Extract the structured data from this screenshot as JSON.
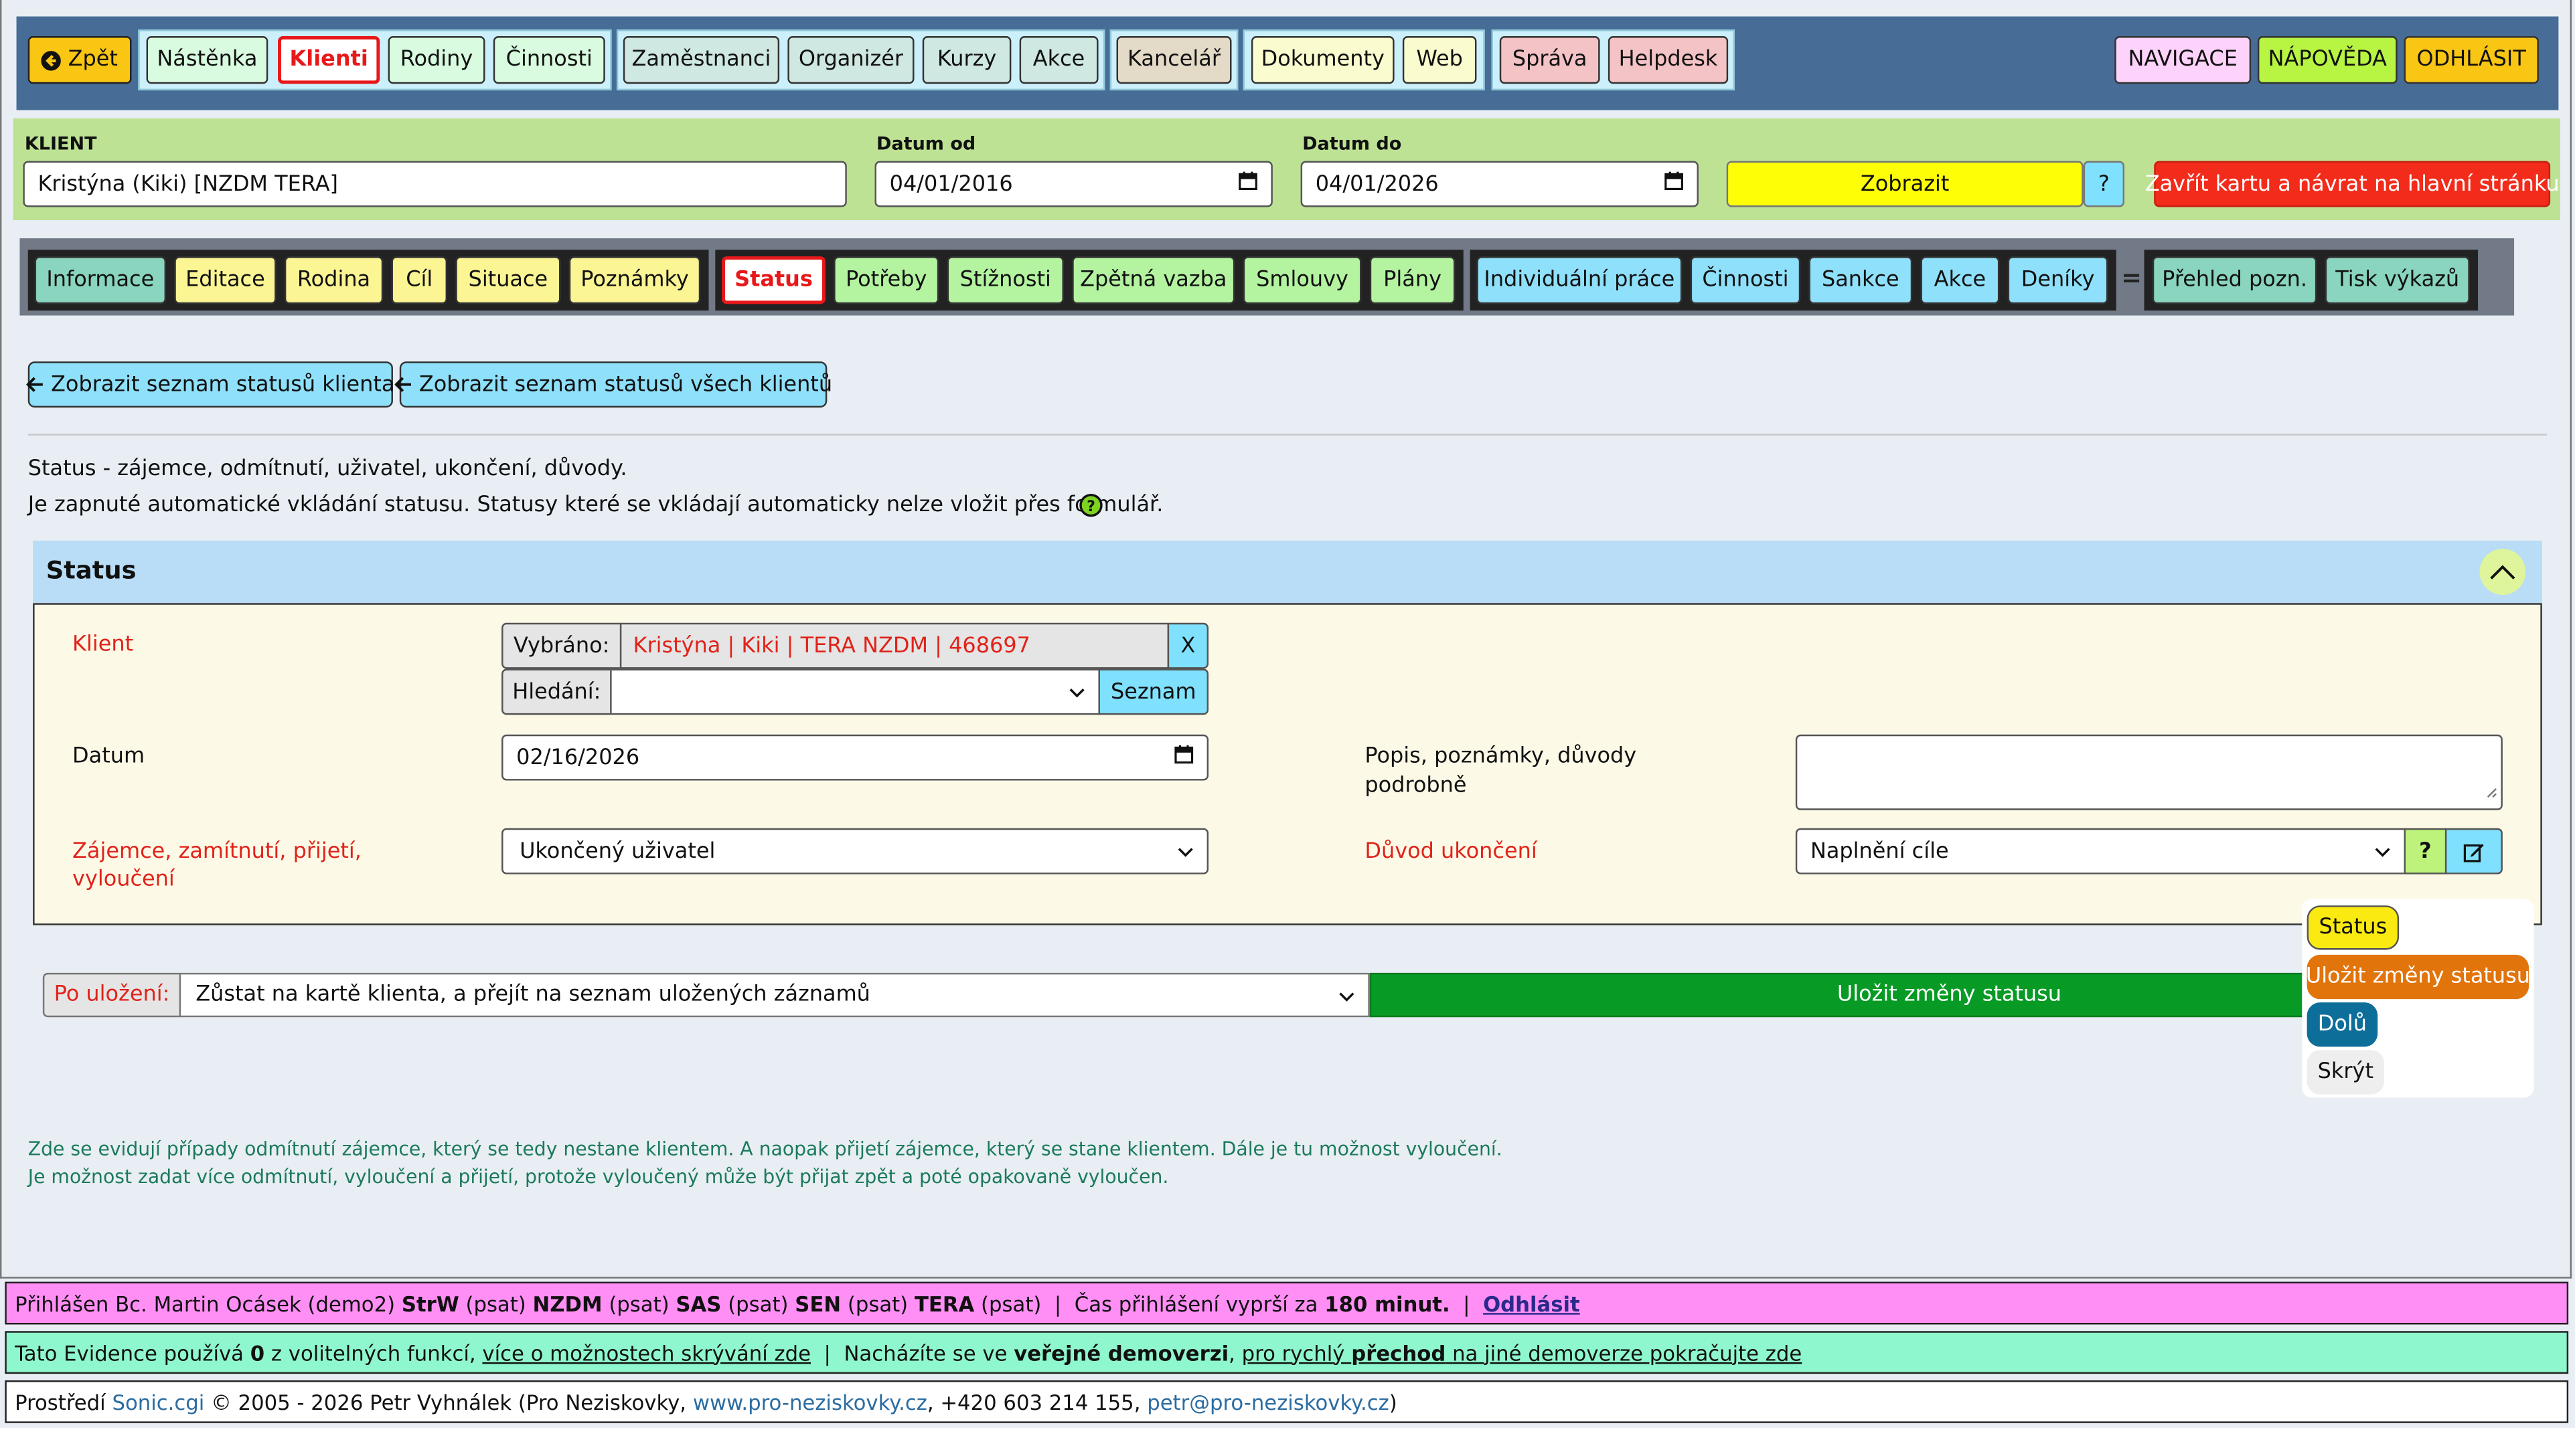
{
  "topnav": {
    "back": "Zpět",
    "items": [
      "Nástěnka",
      "Klienti",
      "Rodiny",
      "Činnosti",
      "Zaměstnanci",
      "Organizér",
      "Kurzy",
      "Akce",
      "Kancelář",
      "Dokumenty",
      "Web",
      "Správa",
      "Helpdesk"
    ],
    "right": [
      "NAVIGACE",
      "NÁPOVĚDA",
      "ODHLÁSIT"
    ]
  },
  "filter": {
    "client_label": "KLIENT",
    "client_value": "Kristýna (Kiki) [NZDM TERA]",
    "date_from_label": "Datum od",
    "date_from_value": "04/01/2016",
    "date_to_label": "Datum do",
    "date_to_value": "04/01/2026",
    "show_button": "Zobrazit",
    "help_button": "?",
    "close_button": "Zavřít kartu a návrat na hlavní stránku"
  },
  "tabs": {
    "group1": [
      "Informace",
      "Editace",
      "Rodina",
      "Cíl",
      "Situace",
      "Poznámky"
    ],
    "group2": [
      "Status",
      "Potřeby",
      "Stížnosti",
      "Zpětná vazba",
      "Smlouvy",
      "Plány"
    ],
    "group3": [
      "Individuální práce",
      "Činnosti",
      "Sankce",
      "Akce",
      "Deníky"
    ],
    "separator": "=",
    "group4": [
      "Přehled pozn.",
      "Tisk výkazů"
    ]
  },
  "actions": {
    "list_client": "Zobrazit seznam statusů klienta",
    "list_all": "Zobrazit seznam statusů všech klientů"
  },
  "intro": {
    "line1": "Status - zájemce, odmítnutí, uživatel, ukončení, důvody.",
    "line2": "Je zapnuté automatické vkládání statusu. Statusy které se vkládají automaticky nelze vložit přes formulář."
  },
  "panel": {
    "title": "Status",
    "client_label": "Klient",
    "selected_prefix": "Vybráno:",
    "selected_value": "Kristýna | Kiki | TERA NZDM | 468697",
    "clear": "X",
    "search_prefix": "Hledání:",
    "list_button": "Seznam",
    "date_label": "Datum",
    "date_value": "02/16/2026",
    "notes_label_1": "Popis, poznámky, důvody",
    "notes_label_2": "podrobně",
    "status_label_1": "Zájemce, zamítnutí, přijetí,",
    "status_label_2": "vyloučení",
    "status_value": "Ukončený uživatel",
    "reason_label": "Důvod ukončení",
    "reason_value": "Naplnění cíle",
    "reason_help": "?"
  },
  "save": {
    "after_label": "Po uložení:",
    "after_value": "Zůstat na kartě klienta, a přejít na seznam uložených záznamů",
    "save_button": "Uložit změny statusu"
  },
  "floating": {
    "status": "Status",
    "save": "Uložit změny statusu",
    "down": "Dolů",
    "hide": "Skrýt"
  },
  "note": {
    "line1": "Zde se evidují případy odmítnutí zájemce, který se tedy nestane klientem. A naopak přijetí zájemce, který se stane klientem. Dále je tu možnost vyloučení.",
    "line2": "Je možnost zadat více odmítnutí, vyloučení a přijetí, protože vyloučený může být přijat zpět a poté opakovaně vyloučen."
  },
  "footer": {
    "login_prefix": "Přihlášen Bc. Martin Ocásek (demo2)",
    "roles": [
      {
        "name": "StrW",
        "role": "(psat)"
      },
      {
        "name": "NZDM",
        "role": "(psat)"
      },
      {
        "name": "SAS",
        "role": "(psat)"
      },
      {
        "name": "SEN",
        "role": "(psat)"
      },
      {
        "name": "TERA",
        "role": "(psat)"
      }
    ],
    "sep": "|",
    "expire_text": "Čas přihlášení vyprší za",
    "expire_value": "180 minut.",
    "logout": "Odhlásit",
    "optional_prefix": "Tato Evidence používá",
    "optional_count": "0",
    "optional_suffix": "z volitelných funkcí,",
    "optional_link": "více o možnostech skrývání zde",
    "demo_prefix": "Nacházíte se ve",
    "demo_bold": "veřejné demoverzi",
    "demo_link_a": "pro rychlý",
    "demo_link_b": "přechod",
    "demo_link_c": "na jiné demoverze pokračujte zde",
    "env_prefix": "Prostředí",
    "env_link": "Sonic.cgi",
    "env_copy": "© 2005 - 2026 Petr Vyhnálek (Pro Neziskovky,",
    "env_web": "www.pro-neziskovky.cz",
    "env_phone": ", +420 603 214 155,",
    "env_mail": "petr@pro-neziskovky.cz",
    "env_close": ")"
  },
  "colors": {
    "topbar": "#476c95",
    "filterbar": "#bde294",
    "tabbar": "#717a86",
    "save_green": "#079b25",
    "danger_red": "#f22b1b",
    "panel_header": "#b9dcf7",
    "panel_body": "#fdf9e7",
    "footer_pink": "#ff8ff5",
    "footer_mint": "#8ff7cd"
  }
}
